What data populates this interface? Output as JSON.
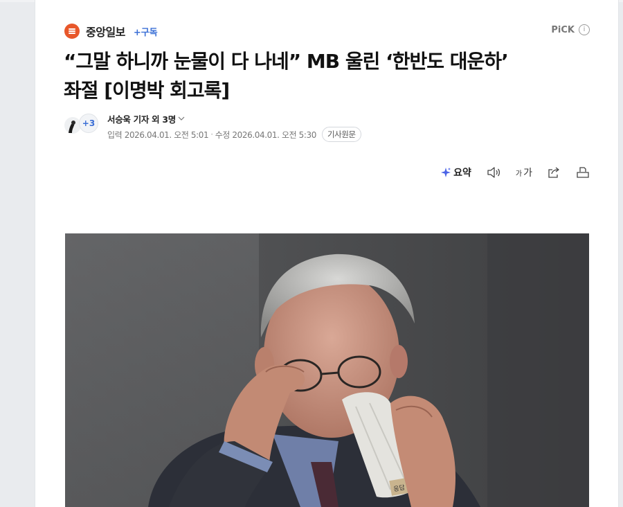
{
  "press": {
    "name": "중앙일보",
    "subscribe_label": "+구독",
    "pick_label": "PiCK",
    "brand_color": "#e8572a"
  },
  "article": {
    "title_line1": "“그말 하니까 눈물이 다 나네” MB 울린 ‘한반도 대운하’",
    "title_line2": "좌절 [이명박 회고록]"
  },
  "byline": {
    "more_count": "+3",
    "reporter": "서승욱 기자 외 3명",
    "input_label": "입력",
    "input_date": "2026.04.01. 오전 5:01",
    "separator": "·",
    "edit_label": "수정",
    "edit_date": "2026.04.01. 오전 5:30",
    "original_label": "기사원문"
  },
  "toolbar": {
    "summary_label": "요약",
    "font_label_small": "가",
    "font_label_large": "가"
  },
  "photo": {
    "tissue_tag": "응답"
  }
}
